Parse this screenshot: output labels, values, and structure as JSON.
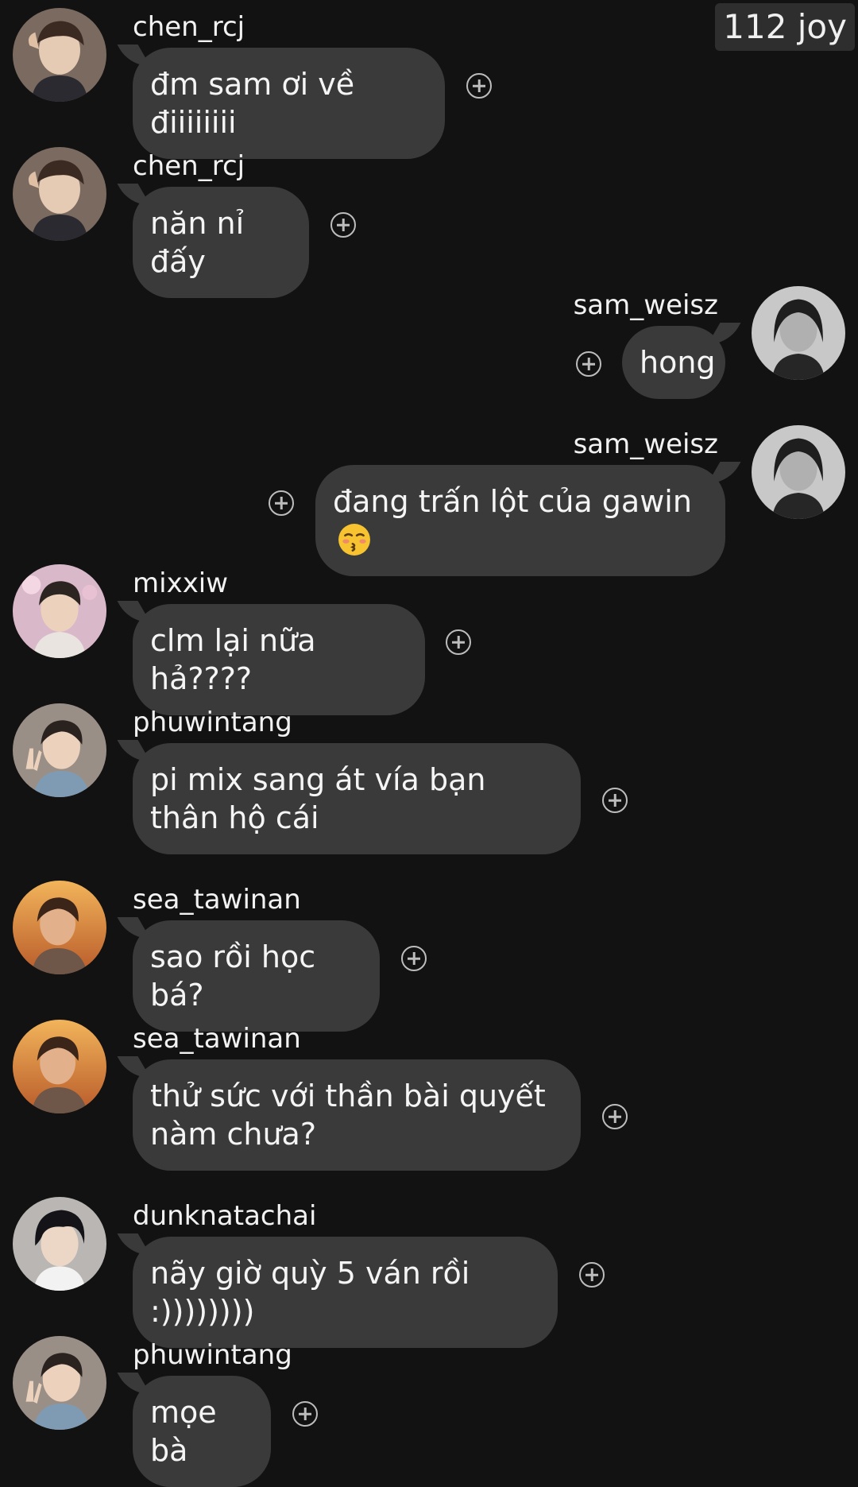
{
  "badge": "112 joy",
  "messages": [
    {
      "user": "chen_rcj",
      "text": "đm sam ơi về điiiiiiii",
      "side": "left"
    },
    {
      "user": "chen_rcj",
      "text": "năn nỉ đấy",
      "side": "left"
    },
    {
      "user": "sam_weisz",
      "text": "hong",
      "side": "right"
    },
    {
      "user": "sam_weisz",
      "text": "đang trấn lột của gawin",
      "emoji": "kissing-face-closed-eyes",
      "side": "right"
    },
    {
      "user": "mixxiw",
      "text": "clm lại nữa hả????",
      "side": "left"
    },
    {
      "user": "phuwintang",
      "text": "pi mix sang át vía bạn thân hộ cái",
      "side": "left"
    },
    {
      "user": "sea_tawinan",
      "text": "sao rồi học bá?",
      "side": "left"
    },
    {
      "user": "sea_tawinan",
      "text": "thử sức với thần bài quyết nàm chưa?",
      "side": "left"
    },
    {
      "user": "dunknatachai",
      "text": "nãy giờ quỳ 5 ván rồi :))))))))",
      "side": "left"
    },
    {
      "user": "phuwintang",
      "text": "mọe bà",
      "side": "left"
    }
  ],
  "icons": {
    "add_reaction": "plus-circle-icon"
  },
  "colors": {
    "background": "#121212",
    "bubble": "#3a3a3a",
    "text": "#f5f5f5",
    "badge_bg": "#2e2e2e"
  }
}
